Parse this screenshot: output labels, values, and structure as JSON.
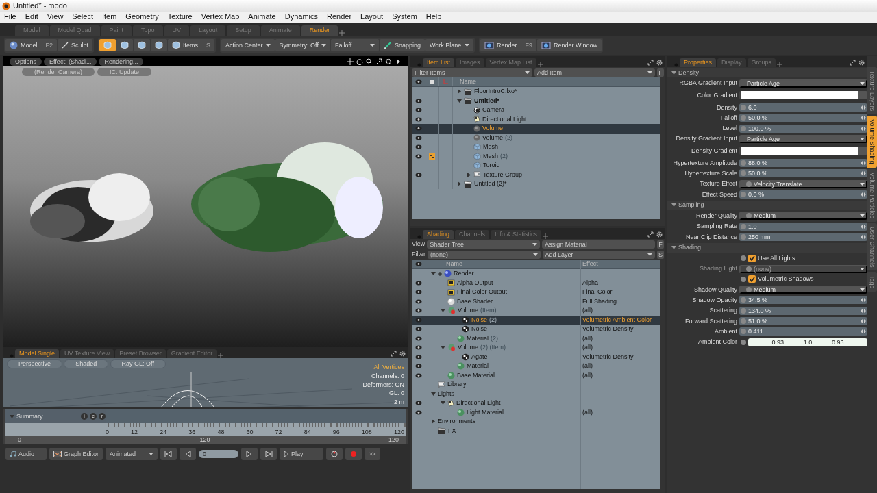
{
  "window": {
    "title": "Untitled* - modo"
  },
  "menu": [
    "File",
    "Edit",
    "View",
    "Select",
    "Item",
    "Geometry",
    "Texture",
    "Vertex Map",
    "Animate",
    "Dynamics",
    "Render",
    "Layout",
    "System",
    "Help"
  ],
  "layout_tabs": [
    {
      "label": "Model",
      "selected": false
    },
    {
      "label": "Model Quad",
      "selected": false
    },
    {
      "label": "Paint",
      "selected": false
    },
    {
      "label": "Topo",
      "selected": false
    },
    {
      "label": "UV",
      "selected": false
    },
    {
      "label": "Layout",
      "selected": false
    },
    {
      "label": "Setup",
      "selected": false
    },
    {
      "label": "Animate",
      "selected": false
    },
    {
      "label": "Render",
      "selected": true
    }
  ],
  "toolbar": [
    [
      {
        "kind": "model",
        "label": "Model",
        "shortcut": "F2"
      },
      {
        "kind": "sculpt",
        "label": "Sculpt"
      }
    ],
    [
      {
        "kind": "toggle",
        "selected": true
      },
      {
        "kind": "toggle",
        "selected": false
      },
      {
        "kind": "toggle",
        "selected": false
      },
      {
        "kind": "toggle",
        "selected": false
      },
      {
        "kind": "items",
        "label": "Items",
        "shortcut": "S"
      }
    ],
    [
      {
        "kind": "dropdown",
        "label": "Action Center"
      },
      {
        "kind": "dropdown",
        "label": "Symmetry: Off"
      },
      {
        "kind": "dropdown",
        "label": "Falloff"
      },
      {
        "kind": "snapping",
        "label": "Snapping"
      },
      {
        "kind": "dropdown",
        "label": "Work Plane"
      }
    ],
    [
      {
        "kind": "render",
        "label": "Render",
        "shortcut": "F9"
      },
      {
        "kind": "render",
        "label": "Render Window"
      }
    ]
  ],
  "viewport": {
    "buttons": [
      "Options",
      "Effect: (Shadi...",
      "Rendering..."
    ],
    "overlay_buttons": [
      "(Render Camera)",
      "IC: Update"
    ]
  },
  "bottom_tabs": [
    {
      "label": "Model Single",
      "selected": true
    },
    {
      "label": "UV Texture View",
      "selected": false
    },
    {
      "label": "Preset Browser",
      "selected": false
    },
    {
      "label": "Gradient Editor",
      "selected": false
    }
  ],
  "gl_view": {
    "buttons": [
      "Perspective",
      "Shaded",
      "Ray GL: Off"
    ],
    "stats": [
      {
        "text": "All Vertices",
        "highlighted": true
      },
      {
        "text": "Channels: 0",
        "highlighted": false
      },
      {
        "text": "Deformers: ON",
        "highlighted": false
      },
      {
        "text": "GL: 0",
        "highlighted": false
      },
      {
        "text": "2 m",
        "highlighted": false
      }
    ]
  },
  "timeline": {
    "label": "Summary",
    "channel_buttons": [
      "i",
      "c",
      "r"
    ],
    "ticks": [
      "0",
      "12",
      "24",
      "36",
      "48",
      "60",
      "72",
      "84",
      "96",
      "108",
      "120"
    ],
    "range": [
      "0",
      "120",
      "120"
    ]
  },
  "transport": {
    "audio": "Audio",
    "graph_editor": "Graph Editor",
    "mode": "Animated",
    "frame": "0",
    "play": "Play",
    "more": ">>"
  },
  "item_list": {
    "tabs": [
      {
        "label": "Item List",
        "selected": true
      },
      {
        "label": "Images",
        "selected": false
      },
      {
        "label": "Vertex Map List",
        "selected": false
      }
    ],
    "filter": "Filter Items",
    "add": "Add Item",
    "filter_button": "F",
    "column": "Name",
    "items": [
      {
        "name": "FloorIntroC.lxo*",
        "kind": "scene",
        "visible": false,
        "marked": false,
        "bold": false,
        "selected": false,
        "expanded": false
      },
      {
        "name": "Untitled*",
        "kind": "scene",
        "visible": true,
        "marked": false,
        "bold": true,
        "selected": false,
        "expanded": true,
        "children": [
          {
            "name": "Camera",
            "kind": "camera",
            "visible": true,
            "marked": false,
            "bold": false,
            "selected": false
          },
          {
            "name": "Directional Light",
            "kind": "light",
            "visible": true,
            "marked": false,
            "bold": false,
            "selected": false
          },
          {
            "name": "Volume",
            "kind": "volume",
            "visible": true,
            "marked": false,
            "bold": false,
            "selected": true
          },
          {
            "name": "Volume",
            "suffix": "(2)",
            "kind": "volume",
            "visible": true,
            "marked": false,
            "bold": false,
            "selected": false
          },
          {
            "name": "Mesh",
            "kind": "mesh",
            "visible": true,
            "marked": false,
            "bold": false,
            "selected": false
          },
          {
            "name": "Mesh",
            "suffix": "(2)",
            "kind": "mesh",
            "visible": true,
            "marked": true,
            "bold": false,
            "selected": false
          },
          {
            "name": "Toroid",
            "kind": "mesh",
            "visible": false,
            "marked": false,
            "bold": false,
            "selected": false
          },
          {
            "name": "Texture Group",
            "kind": "group",
            "visible": true,
            "marked": false,
            "bold": false,
            "selected": false,
            "expanded": false
          }
        ]
      },
      {
        "name": "Untitled (2)*",
        "kind": "scene",
        "visible": false,
        "marked": false,
        "bold": false,
        "selected": false,
        "expanded": false
      }
    ]
  },
  "shading": {
    "tabs": [
      {
        "label": "Shading",
        "selected": true
      },
      {
        "label": "Channels",
        "selected": false
      },
      {
        "label": "Info & Statistics",
        "selected": false
      }
    ],
    "view_label": "View",
    "view": "Shader Tree",
    "assign": "Assign Material",
    "assign_button": "F",
    "filter_label": "Filter",
    "filter": "(none)",
    "add": "Add Layer",
    "add_button": "S",
    "columns": [
      "Name",
      "Effect"
    ],
    "items": [
      {
        "name": "Render",
        "kind": "render",
        "visible": false,
        "selected": false,
        "expanded": true,
        "children": [
          {
            "name": "Alpha Output",
            "kind": "output",
            "effect": "Alpha",
            "visible": true,
            "selected": false
          },
          {
            "name": "Final Color Output",
            "kind": "output",
            "effect": "Final Color",
            "visible": true,
            "selected": false
          },
          {
            "name": "Base Shader",
            "kind": "shader",
            "effect": "Full Shading",
            "visible": true,
            "selected": false
          },
          {
            "name": "Volume",
            "suffix": "(Item)",
            "kind": "mask",
            "effect": "(all)",
            "visible": true,
            "selected": false,
            "expanded": true,
            "children": [
              {
                "name": "Noise",
                "suffix": "(2)",
                "kind": "texture",
                "effect": "Volumetric Ambient Color",
                "visible": true,
                "selected": true
              },
              {
                "name": "Noise",
                "kind": "texture",
                "effect": "Volumetric Density",
                "visible": true,
                "selected": false
              },
              {
                "name": "Material",
                "suffix": "(2)",
                "kind": "material",
                "effect": "(all)",
                "visible": true,
                "selected": false
              }
            ]
          },
          {
            "name": "Volume",
            "suffix": "(2) (Item)",
            "kind": "mask",
            "effect": "(all)",
            "visible": true,
            "selected": false,
            "expanded": true,
            "children": [
              {
                "name": "Agate",
                "kind": "texture",
                "effect": "Volumetric Density",
                "visible": true,
                "selected": false
              },
              {
                "name": "Material",
                "kind": "material",
                "effect": "(all)",
                "visible": true,
                "selected": false
              }
            ]
          },
          {
            "name": "Base Material",
            "kind": "material",
            "effect": "(all)",
            "visible": true,
            "selected": false
          }
        ]
      },
      {
        "name": "Library",
        "kind": "group",
        "visible": false,
        "selected": false
      },
      {
        "name": "Lights",
        "kind": "folder",
        "visible": false,
        "selected": false,
        "expanded": true,
        "children": [
          {
            "name": "Directional Light",
            "kind": "light",
            "visible": true,
            "selected": false,
            "expanded": true,
            "children": [
              {
                "name": "Light Material",
                "kind": "material",
                "effect": "(all)",
                "visible": true,
                "selected": false
              }
            ]
          }
        ]
      },
      {
        "name": "Environments",
        "kind": "folder",
        "visible": false,
        "selected": false,
        "expanded": false
      },
      {
        "name": "FX",
        "kind": "scene",
        "visible": false,
        "selected": false
      }
    ]
  },
  "properties": {
    "tabs": [
      {
        "label": "Properties",
        "selected": true
      },
      {
        "label": "Display",
        "selected": false
      },
      {
        "label": "Groups",
        "selected": false
      }
    ],
    "side_tabs": [
      {
        "label": "Texture Layers",
        "selected": false
      },
      {
        "label": "Volume Shading",
        "selected": true
      },
      {
        "label": "Volume Particles",
        "selected": false
      },
      {
        "label": "User Channels",
        "selected": false
      },
      {
        "label": "Tags",
        "selected": false
      }
    ],
    "sections": [
      {
        "title": "Density",
        "rows": [
          {
            "kind": "dropdown",
            "label": "RGBA Gradient Input",
            "value": "Particle Age",
            "dot": false,
            "disabled": false
          },
          {
            "kind": "gradient",
            "label": "Color Gradient"
          },
          {
            "kind": "number",
            "label": "Density",
            "value": "6.0"
          },
          {
            "kind": "number",
            "label": "Falloff",
            "value": "50.0 %"
          },
          {
            "kind": "number",
            "label": "Level",
            "value": "100.0 %"
          },
          {
            "kind": "dropdown",
            "label": "Density Gradient Input",
            "value": "Particle Age",
            "dot": false,
            "disabled": false
          },
          {
            "kind": "gradient",
            "label": "Density Gradient"
          },
          {
            "kind": "number",
            "label": "Hypertexture Amplitude",
            "value": "88.0 %"
          },
          {
            "kind": "number",
            "label": "Hypertexture Scale",
            "value": "50.0 %"
          },
          {
            "kind": "dropdown",
            "label": "Texture Effect",
            "value": "Velocity Translate",
            "dot": true,
            "disabled": false
          },
          {
            "kind": "number",
            "label": "Effect Speed",
            "value": "0.0 %"
          }
        ]
      },
      {
        "title": "Sampling",
        "rows": [
          {
            "kind": "dropdown",
            "label": "Render Quality",
            "value": "Medium",
            "dot": true,
            "disabled": false
          },
          {
            "kind": "number",
            "label": "Sampling Rate",
            "value": "1.0"
          },
          {
            "kind": "number",
            "label": "Near Clip Distance",
            "value": "250 mm"
          }
        ]
      },
      {
        "title": "Shading",
        "rows": [
          {
            "kind": "checkbox",
            "label": "Use All Lights",
            "checked": true
          },
          {
            "kind": "dropdown",
            "label": "Shading Light",
            "value": "(none)",
            "dot": true,
            "disabled": true
          },
          {
            "kind": "checkbox",
            "label": "Volumetric Shadows",
            "checked": true
          },
          {
            "kind": "dropdown",
            "label": "Shadow Quality",
            "value": "Medium",
            "dot": true,
            "disabled": false
          },
          {
            "kind": "number",
            "label": "Shadow Opacity",
            "value": "34.5 %"
          },
          {
            "kind": "number",
            "label": "Scattering",
            "value": "134.0 %"
          },
          {
            "kind": "number",
            "label": "Forward Scattering",
            "value": "51.0 %"
          },
          {
            "kind": "number",
            "label": "Ambient",
            "value": "0.411"
          },
          {
            "kind": "color",
            "label": "Ambient Color",
            "values": [
              "0.93",
              "1.0",
              "0.93"
            ]
          }
        ]
      }
    ]
  }
}
